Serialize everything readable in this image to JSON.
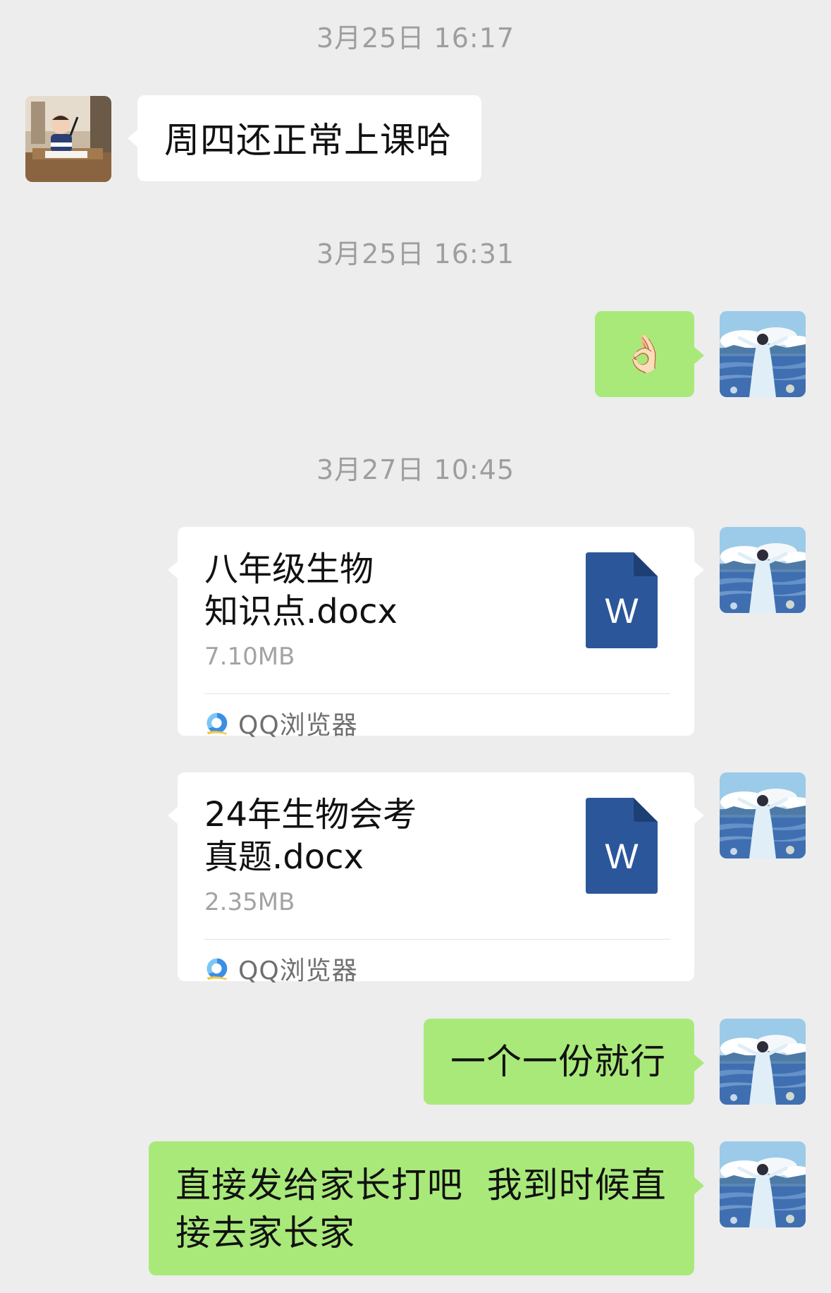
{
  "colors": {
    "background": "#ededed",
    "incoming_bubble": "#ffffff",
    "outgoing_bubble": "#a9e97a",
    "timestamp": "#9e9e9e",
    "word_icon": "#2b579a"
  },
  "messages": {
    "ts1": "3月25日 16:17",
    "msg1": "周四还正常上课哈",
    "ts2": "3月25日 16:31",
    "msg2_emoji": "👌🏻",
    "ts3": "3月27日 10:45",
    "file1": {
      "name": "八年级生物\n知识点.docx",
      "size": "7.10MB",
      "source": "QQ浏览器",
      "icon": "word-document-icon",
      "icon_letter": "W"
    },
    "file2": {
      "name": "24年生物会考\n真题.docx",
      "size": "2.35MB",
      "source": "QQ浏览器",
      "icon": "word-document-icon",
      "icon_letter": "W"
    },
    "msg5": "一个一份就行",
    "msg6": "直接发给家长打吧  我到时候直\n接去家长家"
  }
}
